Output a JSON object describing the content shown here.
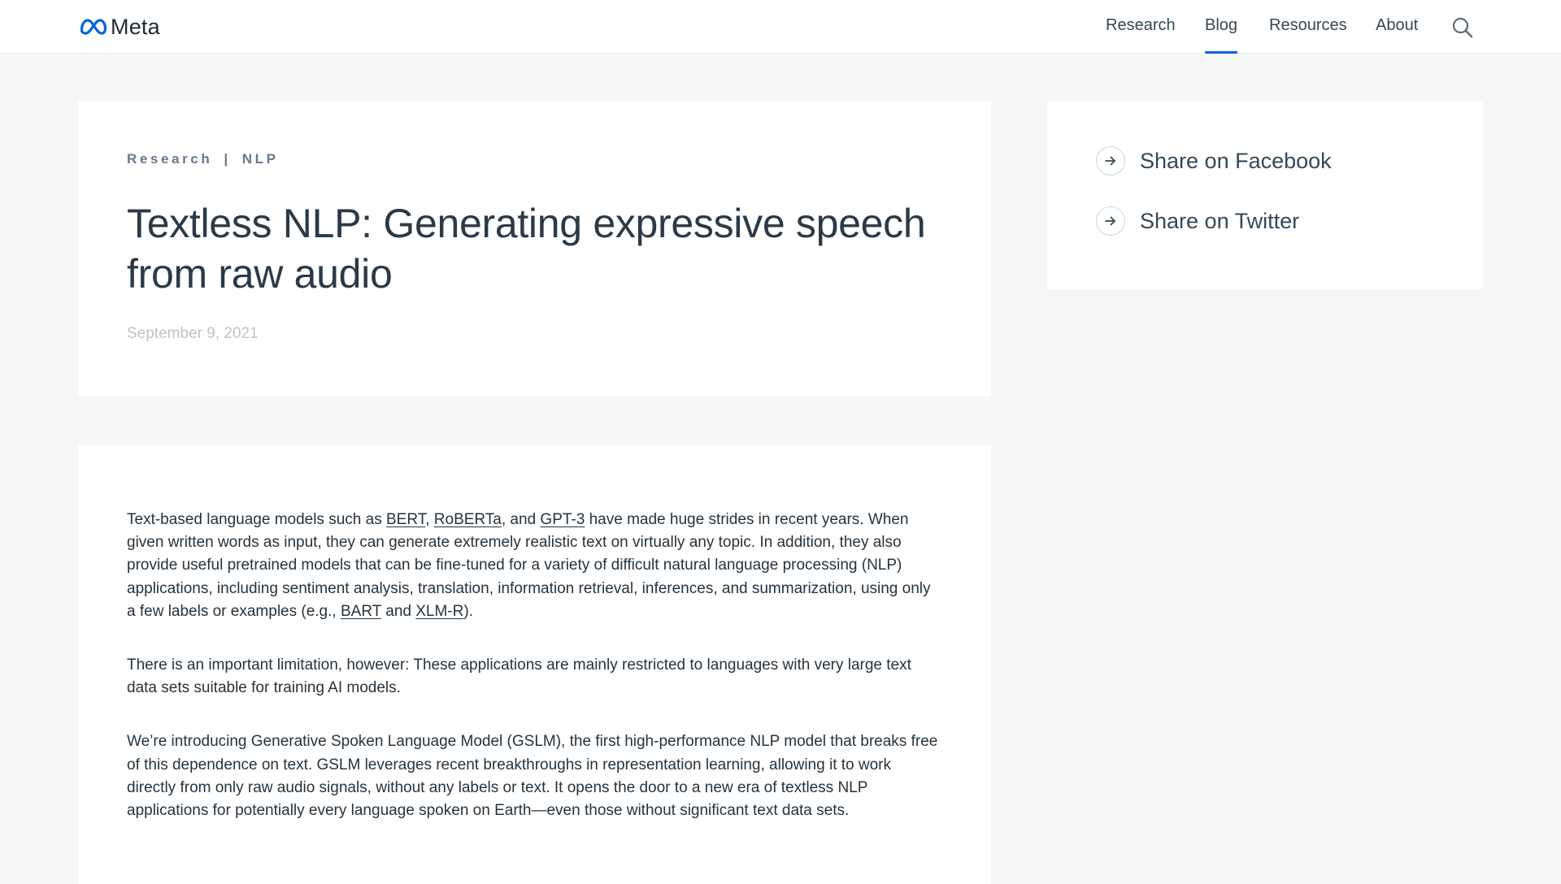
{
  "header": {
    "brand": "Meta",
    "nav": [
      {
        "label": "Research",
        "active": false
      },
      {
        "label": "Blog",
        "active": true
      },
      {
        "label": "Resources",
        "active": false
      },
      {
        "label": "About",
        "active": false
      }
    ],
    "search_icon": "search-icon"
  },
  "colors": {
    "accent": "#0064e0",
    "page_bg": "#f5f6f6",
    "card_bg": "#ffffff",
    "text": "#1c2b33"
  },
  "post": {
    "category": "Research",
    "separator": "|",
    "topic": "NLP",
    "title": "Textless NLP: Generating expressive speech from raw audio",
    "date": "September 9, 2021"
  },
  "share": {
    "facebook": "Share on Facebook",
    "twitter": "Share on Twitter",
    "icon": "arrow-right-icon"
  },
  "article": {
    "p1": {
      "t1": "Text-based language models such as ",
      "link1": "BERT",
      "t2": ", ",
      "link2": "RoBERTa",
      "t3": ", and ",
      "link3": "GPT-3",
      "t4": " have made huge strides in recent years. When given written words as input, they can generate extremely realistic text on virtually any topic. In addition, they also provide useful pretrained models that can be fine-tuned for a variety of difficult natural language processing (NLP) applications, including sentiment analysis, translation, information retrieval, inferences, and summarization, using only a few labels or examples (e.g., ",
      "link4": "BART",
      "t5": " and ",
      "link5": "XLM-R",
      "t6": ")."
    },
    "p2": "There is an important limitation, however: These applications are mainly restricted to languages with very large text data sets suitable for training AI models.",
    "p3": "We’re introducing Generative Spoken Language Model (GSLM), the first high-performance NLP model that breaks free of this dependence on text. GSLM leverages recent breakthroughs in representation learning, allowing it to work directly from only raw audio signals, without any labels or text. It opens the door to a new era of textless NLP applications for potentially every language spoken on Earth—even those without significant text data sets."
  }
}
